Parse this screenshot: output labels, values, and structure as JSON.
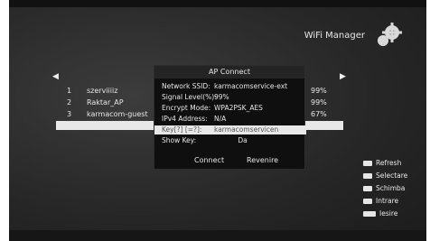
{
  "header": {
    "title": "WiFi Manager"
  },
  "networks": [
    {
      "num": "1",
      "ssid": "szerviiiiz",
      "signal": "99%"
    },
    {
      "num": "2",
      "ssid": "Raktar_AP",
      "signal": "99%"
    },
    {
      "num": "3",
      "ssid": "karmacom-guest",
      "signal": "67%"
    }
  ],
  "dialog": {
    "title": "AP Connect",
    "rows": [
      {
        "label": "Network SSID:",
        "value": "karmacomservice-ext"
      },
      {
        "label": "Signal Level(%):",
        "value": "99%"
      },
      {
        "label": "Encrypt Mode:",
        "value": "WPA2PSK_AES"
      },
      {
        "label": "IPv4 Address:",
        "value": "N/A"
      },
      {
        "label": "Key[?] [=?]:",
        "value": "karmacomservicen"
      },
      {
        "label": "Show Key:",
        "value": "Da"
      }
    ],
    "connect_label": "Connect",
    "cancel_label": "Revenire"
  },
  "legend": [
    {
      "key": "red",
      "label": "Refresh"
    },
    {
      "key": "ch",
      "label": "Selectare"
    },
    {
      "key": "lr",
      "label": "Schimba"
    },
    {
      "key": "OK",
      "label": "Intrare"
    },
    {
      "key": "EXIT",
      "label": "Iesire"
    }
  ]
}
